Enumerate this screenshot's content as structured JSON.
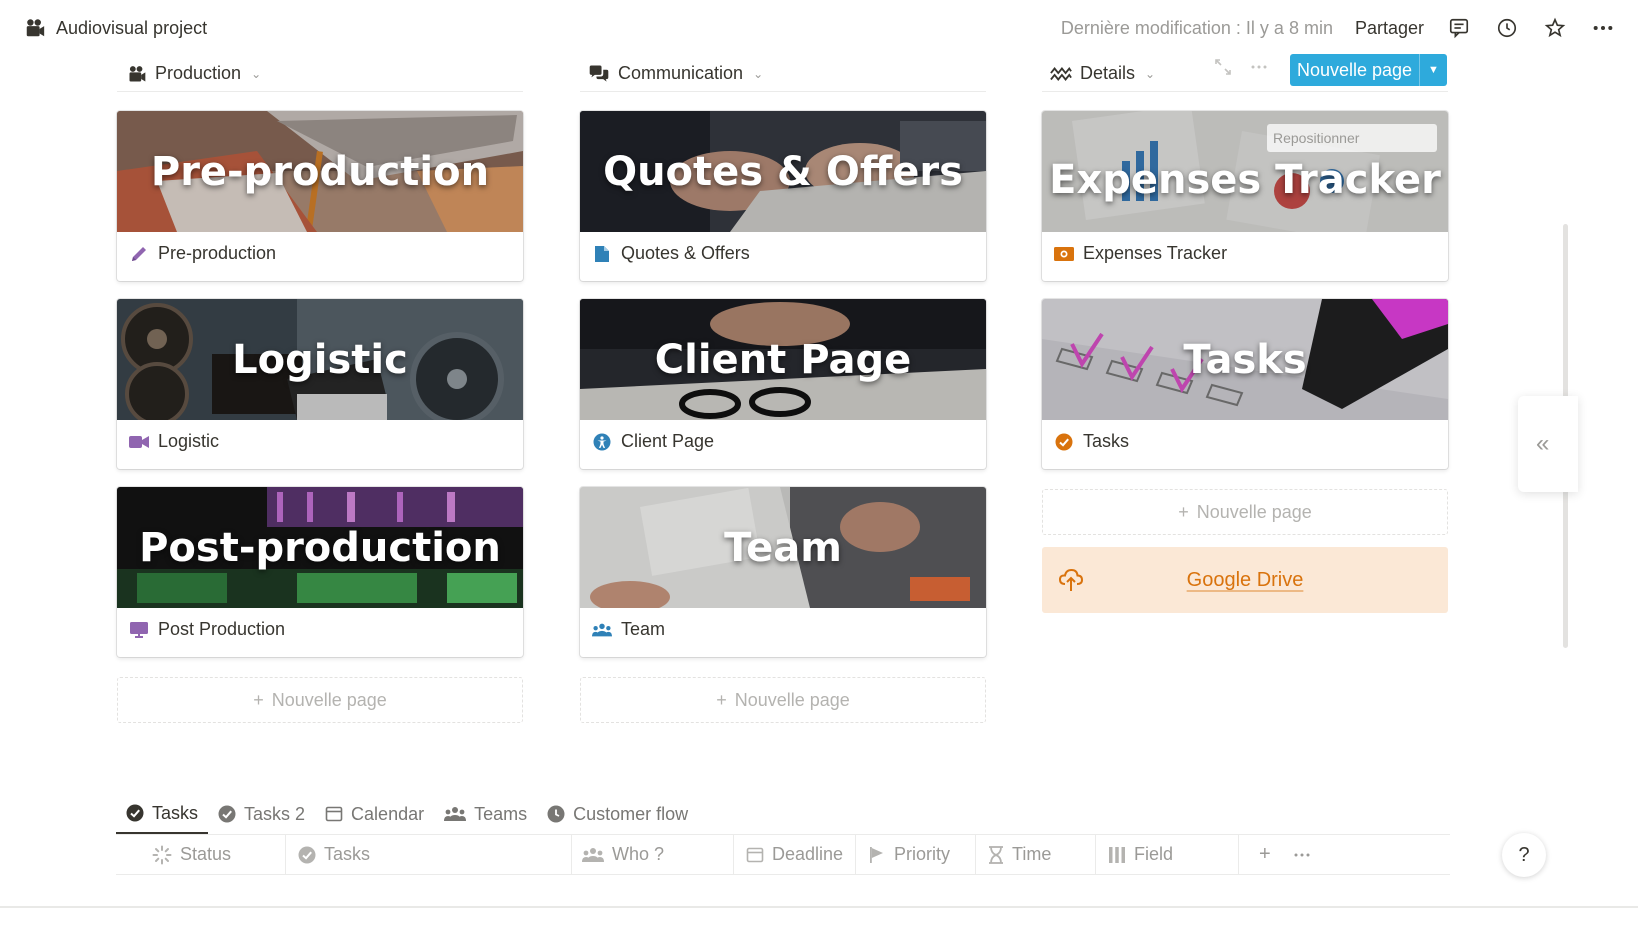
{
  "topbar": {
    "title": "Audiovisual project",
    "last_modified": "Dernière modification : Il y a 8 min",
    "share": "Partager"
  },
  "board": {
    "columns": [
      {
        "name": "Production",
        "cards": [
          {
            "cover_title": "Pre-production",
            "label": "Pre-production",
            "icon": "pencil-icon"
          },
          {
            "cover_title": "Logistic",
            "label": "Logistic",
            "icon": "video-camera-icon"
          },
          {
            "cover_title": "Post-production",
            "label": "Post Production",
            "icon": "monitor-icon"
          }
        ],
        "new_page": "Nouvelle page"
      },
      {
        "name": "Communication",
        "cards": [
          {
            "cover_title": "Quotes & Offers",
            "label": "Quotes & Offers",
            "icon": "document-icon"
          },
          {
            "cover_title": "Client Page",
            "label": "Client Page",
            "icon": "accessibility-icon"
          },
          {
            "cover_title": "Team",
            "label": "Team",
            "icon": "users-icon"
          }
        ],
        "new_page": "Nouvelle page"
      },
      {
        "name": "Details",
        "cards": [
          {
            "cover_title": "Expenses Tracker",
            "label": "Expenses Tracker",
            "icon": "money-icon"
          },
          {
            "cover_title": "Tasks",
            "label": "Tasks",
            "icon": "check-circle-icon"
          }
        ],
        "new_page": "Nouvelle page",
        "reposition": "Repositionner",
        "link": {
          "label": "Google Drive",
          "icon": "cloud-upload-icon"
        }
      }
    ],
    "new_button": "Nouvelle page"
  },
  "tabs": [
    {
      "label": "Tasks",
      "icon": "check-circle-icon",
      "active": true
    },
    {
      "label": "Tasks 2",
      "icon": "check-circle-icon",
      "active": false
    },
    {
      "label": "Calendar",
      "icon": "calendar-icon",
      "active": false
    },
    {
      "label": "Teams",
      "icon": "users-icon",
      "active": false
    },
    {
      "label": "Customer flow",
      "icon": "clock-icon",
      "active": false
    }
  ],
  "properties": [
    {
      "label": "Status",
      "icon": "loading-icon"
    },
    {
      "label": "Tasks",
      "icon": "check-circle-icon"
    },
    {
      "label": "Who ?",
      "icon": "users-icon"
    },
    {
      "label": "Deadline",
      "icon": "calendar-icon"
    },
    {
      "label": "Priority",
      "icon": "flag-icon"
    },
    {
      "label": "Time",
      "icon": "hourglass-icon"
    },
    {
      "label": "Field",
      "icon": "columns-icon"
    }
  ],
  "help": "?",
  "colors": {
    "accent": "#2eaadc",
    "drive_bg": "#fbe8d6",
    "drive_text": "#d9730d",
    "pencil": "#9065b0",
    "doc": "#2f81b7",
    "money": "#d9730d"
  }
}
